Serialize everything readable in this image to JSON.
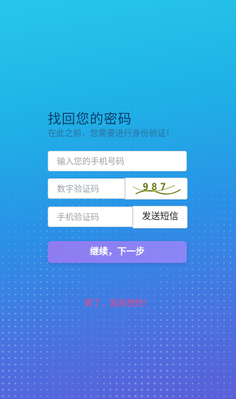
{
  "page": {
    "title": "找回您的密码",
    "subtitle": "在此之前，您需要进行身份验证！"
  },
  "form": {
    "phone_placeholder": "输入您的手机号码",
    "captcha_placeholder": "数字验证码",
    "captcha_image_text": "987",
    "sms_placeholder": "手机验证码",
    "send_sms_label": "发送短信",
    "submit_label": "继续，下一步"
  },
  "footer": {
    "cancel_label": "算了，我再想想！"
  },
  "colors": {
    "background_top": "#27c7ea",
    "background_bottom": "#5a5fd8",
    "submit_button": "#8f7cf0",
    "cancel_link": "#e04a8a",
    "title_text": "#0b3a66"
  }
}
